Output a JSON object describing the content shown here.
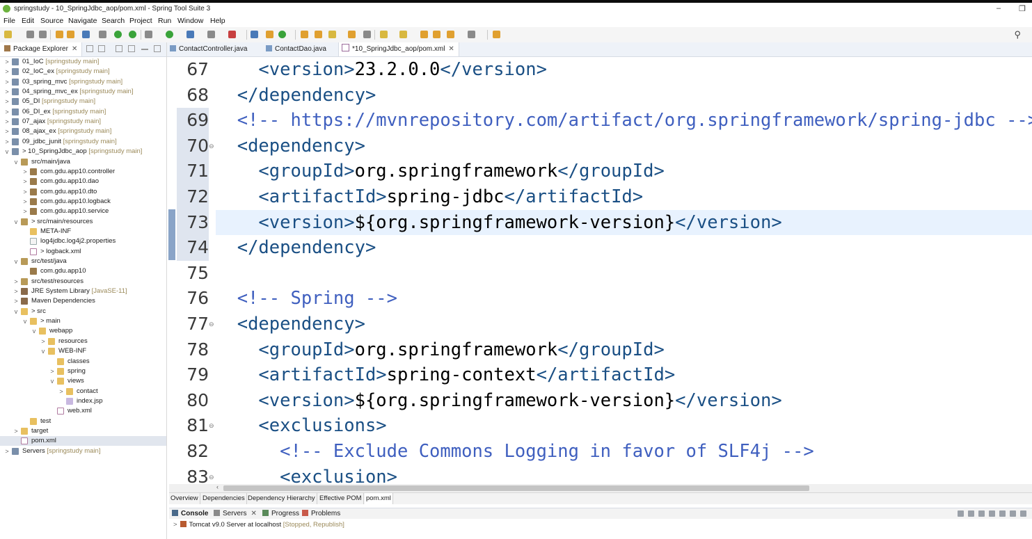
{
  "window": {
    "title": "springstudy - 10_SpringJdbc_aop/pom.xml - Spring Tool Suite 3",
    "minimize_glyph": "–",
    "restore_glyph": "❐"
  },
  "menu": [
    "File",
    "Edit",
    "Source",
    "Navigate",
    "Search",
    "Project",
    "Run",
    "Window",
    "Help"
  ],
  "toolbar": {
    "search_icon": "search-icon"
  },
  "package_explorer": {
    "tab_label": "Package Explorer",
    "tree": [
      {
        "twisty": ">",
        "icon": "prj",
        "label": "01_IoC",
        "decor": "[springstudy main]"
      },
      {
        "twisty": ">",
        "icon": "prj",
        "label": "02_IoC_ex",
        "decor": "[springstudy main]"
      },
      {
        "twisty": ">",
        "icon": "prj",
        "label": "03_spring_mvc",
        "decor": "[springstudy main]"
      },
      {
        "twisty": ">",
        "icon": "prj",
        "label": "04_spring_mvc_ex",
        "decor": "[springstudy main]"
      },
      {
        "twisty": ">",
        "icon": "prj",
        "label": "05_DI",
        "decor": "[springstudy main]"
      },
      {
        "twisty": ">",
        "icon": "prj",
        "label": "06_DI_ex",
        "decor": "[springstudy main]"
      },
      {
        "twisty": ">",
        "icon": "prj",
        "label": "07_ajax",
        "decor": "[springstudy main]"
      },
      {
        "twisty": ">",
        "icon": "prj",
        "label": "08_ajax_ex",
        "decor": "[springstudy main]"
      },
      {
        "twisty": ">",
        "icon": "prj",
        "label": "09_jdbc_junit",
        "decor": "[springstudy main]"
      },
      {
        "twisty": "v",
        "icon": "prj",
        "label": "> 10_SpringJdbc_aop",
        "decor": "[springstudy main]"
      },
      {
        "twisty": "v",
        "icon": "src",
        "label": "src/main/java",
        "decor": ""
      },
      {
        "twisty": ">",
        "icon": "pkg",
        "label": "com.gdu.app10.controller",
        "decor": ""
      },
      {
        "twisty": ">",
        "icon": "pkg",
        "label": "com.gdu.app10.dao",
        "decor": ""
      },
      {
        "twisty": ">",
        "icon": "pkg",
        "label": "com.gdu.app10.dto",
        "decor": ""
      },
      {
        "twisty": ">",
        "icon": "pkg",
        "label": "com.gdu.app10.logback",
        "decor": ""
      },
      {
        "twisty": ">",
        "icon": "pkg",
        "label": "com.gdu.app10.service",
        "decor": ""
      },
      {
        "twisty": "v",
        "icon": "src",
        "label": "> src/main/resources",
        "decor": ""
      },
      {
        "twisty": "",
        "icon": "fold",
        "label": "META-INF",
        "decor": ""
      },
      {
        "twisty": "",
        "icon": "file",
        "label": "log4jdbc.log4j2.properties",
        "decor": ""
      },
      {
        "twisty": "",
        "icon": "xml",
        "label": "> logback.xml",
        "decor": ""
      },
      {
        "twisty": "v",
        "icon": "src",
        "label": "src/test/java",
        "decor": ""
      },
      {
        "twisty": "",
        "icon": "pkg",
        "label": "com.gdu.app10",
        "decor": ""
      },
      {
        "twisty": ">",
        "icon": "src",
        "label": "src/test/resources",
        "decor": ""
      },
      {
        "twisty": ">",
        "icon": "lib",
        "label": "JRE System Library",
        "decor": "[JavaSE-11]"
      },
      {
        "twisty": ">",
        "icon": "lib",
        "label": "Maven Dependencies",
        "decor": ""
      },
      {
        "twisty": "v",
        "icon": "fold",
        "label": "> src",
        "decor": ""
      },
      {
        "twisty": "v",
        "icon": "fold",
        "label": "> main",
        "decor": ""
      },
      {
        "twisty": "v",
        "icon": "fold",
        "label": "webapp",
        "decor": ""
      },
      {
        "twisty": ">",
        "icon": "fold",
        "label": "resources",
        "decor": ""
      },
      {
        "twisty": "v",
        "icon": "fold",
        "label": "WEB-INF",
        "decor": ""
      },
      {
        "twisty": "",
        "icon": "fold",
        "label": "classes",
        "decor": ""
      },
      {
        "twisty": ">",
        "icon": "fold",
        "label": "spring",
        "decor": ""
      },
      {
        "twisty": "v",
        "icon": "fold",
        "label": "views",
        "decor": ""
      },
      {
        "twisty": ">",
        "icon": "fold",
        "label": "contact",
        "decor": ""
      },
      {
        "twisty": "",
        "icon": "jsp",
        "label": "index.jsp",
        "decor": ""
      },
      {
        "twisty": "",
        "icon": "xml",
        "label": "web.xml",
        "decor": ""
      },
      {
        "twisty": "",
        "icon": "fold",
        "label": "test",
        "decor": ""
      },
      {
        "twisty": ">",
        "icon": "fold",
        "label": "target",
        "decor": ""
      },
      {
        "twisty": "",
        "icon": "xml",
        "label": "pom.xml",
        "decor": ""
      },
      {
        "twisty": ">",
        "icon": "prj",
        "label": "Servers",
        "decor": "[springstudy main]"
      }
    ]
  },
  "editor_tabs": [
    {
      "label": "ContactController.java",
      "active": false
    },
    {
      "label": "ContactDao.java",
      "active": false
    },
    {
      "label": "*10_SpringJdbc_aop/pom.xml",
      "active": true
    }
  ],
  "code_lines": [
    {
      "no": "67",
      "fold": "",
      "text": "    <version>23.2.0.0</version>"
    },
    {
      "no": "68",
      "fold": "",
      "text": "  </dependency>"
    },
    {
      "no": "69",
      "fold": "",
      "text": "  <!-- https://mvnrepository.com/artifact/org.springframework/spring-jdbc -->"
    },
    {
      "no": "70",
      "fold": "⊖",
      "text": "  <dependency>"
    },
    {
      "no": "71",
      "fold": "",
      "text": "    <groupId>org.springframework</groupId>"
    },
    {
      "no": "72",
      "fold": "",
      "text": "    <artifactId>spring-jdbc</artifactId>"
    },
    {
      "no": "73",
      "fold": "",
      "text": "    <version>${org.springframework-version}</version>"
    },
    {
      "no": "74",
      "fold": "",
      "text": "  </dependency>"
    },
    {
      "no": "75",
      "fold": "",
      "text": ""
    },
    {
      "no": "76",
      "fold": "",
      "text": "  <!-- Spring -->"
    },
    {
      "no": "77",
      "fold": "⊖",
      "text": "  <dependency>"
    },
    {
      "no": "78",
      "fold": "",
      "text": "    <groupId>org.springframework</groupId>"
    },
    {
      "no": "79",
      "fold": "",
      "text": "    <artifactId>spring-context</artifactId>"
    },
    {
      "no": "80",
      "fold": "",
      "text": "    <version>${org.springframework-version}</version>"
    },
    {
      "no": "81",
      "fold": "⊖",
      "text": "    <exclusions>"
    },
    {
      "no": "82",
      "fold": "",
      "text": "      <!-- Exclude Commons Logging in favor of SLF4j -->"
    },
    {
      "no": "83",
      "fold": "⊖",
      "text": "      <exclusion>"
    }
  ],
  "pom_tabs": [
    "Overview",
    "Dependencies",
    "Dependency Hierarchy",
    "Effective POM",
    "pom.xml"
  ],
  "console_tabs": [
    "Console",
    "Servers",
    "Progress",
    "Problems"
  ],
  "console": {
    "server_label": "Tomcat v9.0 Server at localhost",
    "server_state": "[Stopped, Republish]"
  }
}
